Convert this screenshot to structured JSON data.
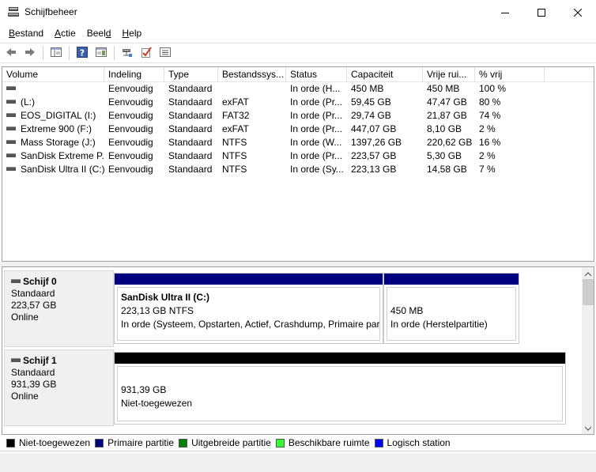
{
  "window": {
    "title": "Schijfbeheer"
  },
  "menu": [
    {
      "label": "Bestand",
      "u": "B",
      "rest": "estand"
    },
    {
      "label": "Actie",
      "u": "A",
      "rest": "ctie"
    },
    {
      "label": "Beeld",
      "u": "Bee",
      "rest": "ld",
      "ufirst": false
    },
    {
      "label": "Help",
      "u": "H",
      "rest": "elp"
    }
  ],
  "menu_labels": {
    "bestand_u": "B",
    "bestand_r": "estand",
    "actie_u": "A",
    "actie_r": "ctie",
    "beeld_a": "Beel",
    "beeld_u": "d",
    "help_u": "H",
    "help_r": "elp"
  },
  "volumes": {
    "columns": [
      "Volume",
      "Indeling",
      "Type",
      "Bestandssys...",
      "Status",
      "Capaciteit",
      "Vrije rui...",
      "% vrij"
    ],
    "rows": [
      [
        "",
        "Eenvoudig",
        "Standaard",
        "",
        "In orde (H...",
        "450 MB",
        "450 MB",
        "100 %"
      ],
      [
        "(L:)",
        "Eenvoudig",
        "Standaard",
        "exFAT",
        "In orde (Pr...",
        "59,45 GB",
        "47,47 GB",
        "80 %"
      ],
      [
        "EOS_DIGITAL (I:)",
        "Eenvoudig",
        "Standaard",
        "FAT32",
        "In orde (Pr...",
        "29,74 GB",
        "21,87 GB",
        "74 %"
      ],
      [
        "Extreme 900 (F:)",
        "Eenvoudig",
        "Standaard",
        "exFAT",
        "In orde (Pr...",
        "447,07 GB",
        "8,10 GB",
        "2 %"
      ],
      [
        "Mass Storage (J:)",
        "Eenvoudig",
        "Standaard",
        "NTFS",
        "In orde (W...",
        "1397,26 GB",
        "220,62 GB",
        "16 %"
      ],
      [
        "SanDisk Extreme P...",
        "Eenvoudig",
        "Standaard",
        "NTFS",
        "In orde (Pr...",
        "223,57 GB",
        "5,30 GB",
        "2 %"
      ],
      [
        "SanDisk Ultra II (C:)",
        "Eenvoudig",
        "Standaard",
        "NTFS",
        "In orde (Sy...",
        "223,13 GB",
        "14,58 GB",
        "7 %"
      ]
    ]
  },
  "disks": [
    {
      "name": "Schijf 0",
      "type": "Standaard",
      "size": "223,57 GB",
      "state": "Online",
      "partitions": [
        {
          "name": "SanDisk Ultra II  (C:)",
          "size": "223,13 GB NTFS",
          "status": "In orde (Systeem, Opstarten, Actief, Crashdump, Primaire part",
          "bar_color": "#00007f"
        },
        {
          "name": "",
          "size": "450 MB",
          "status": "In orde (Herstelpartitie)",
          "bar_color": "#00007f"
        }
      ]
    },
    {
      "name": "Schijf 1",
      "type": "Standaard",
      "size": "931,39 GB",
      "state": "Online",
      "partitions": [
        {
          "name": "",
          "size": "931,39 GB",
          "status": "Niet-toegewezen",
          "bar_color": "#000000"
        }
      ]
    }
  ],
  "legend": [
    {
      "label": "Niet-toegewezen",
      "color": "#000000"
    },
    {
      "label": "Primaire partitie",
      "color": "#00007f"
    },
    {
      "label": "Uitgebreide partitie",
      "color": "#007f00"
    },
    {
      "label": "Beschikbare ruimte",
      "color": "#33ff33"
    },
    {
      "label": "Logisch station",
      "color": "#0000ff"
    }
  ],
  "icons": {
    "app": "disk-management-icon",
    "toolbar": [
      "back-arrow-icon",
      "forward-arrow-icon",
      "console-tree-icon",
      "help-icon",
      "properties-pane-icon",
      "connect-drive-icon",
      "check-icon",
      "list-view-icon"
    ]
  }
}
